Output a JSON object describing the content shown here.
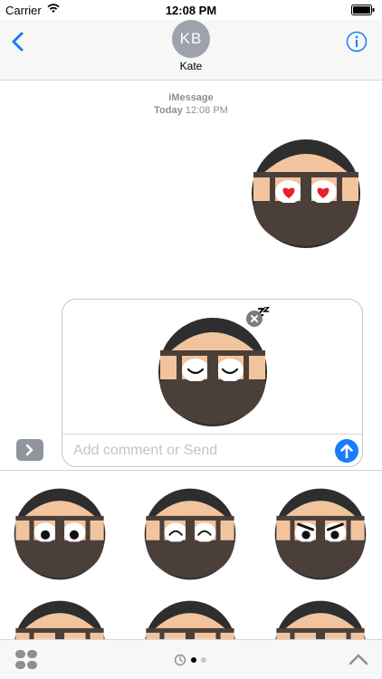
{
  "status_bar": {
    "carrier": "Carrier",
    "time": "12:08 PM"
  },
  "nav": {
    "avatar_initials": "KB",
    "contact_name": "Kate"
  },
  "thread": {
    "service": "iMessage",
    "date_label": "Today",
    "time_label": "12:08 PM"
  },
  "compose": {
    "placeholder": "Add comment or Send",
    "value": ""
  },
  "colors": {
    "accent": "#1a7cf6",
    "heart": "#e8202c",
    "mask": "#4b3f3a",
    "skin": "#f2c49d",
    "outline": "#2e2e2e"
  },
  "icons": {
    "back": "chevron-left-icon",
    "info": "info-icon",
    "expand": "chevron-right-icon",
    "remove": "close-icon",
    "send": "arrow-up-icon",
    "apps": "app-grid-icon",
    "recents": "clock-icon",
    "collapse": "chevron-up-icon"
  },
  "stickers": {
    "sent": {
      "eyes": "hearts"
    },
    "staged": {
      "eyes": "sleeping"
    },
    "drawer": [
      {
        "eyes": "wide-open"
      },
      {
        "eyes": "happy"
      },
      {
        "eyes": "angry"
      },
      {
        "eyes": "partial"
      },
      {
        "eyes": "partial"
      },
      {
        "eyes": "partial"
      }
    ]
  },
  "page_indicator": {
    "pages": 2,
    "current": 1
  }
}
